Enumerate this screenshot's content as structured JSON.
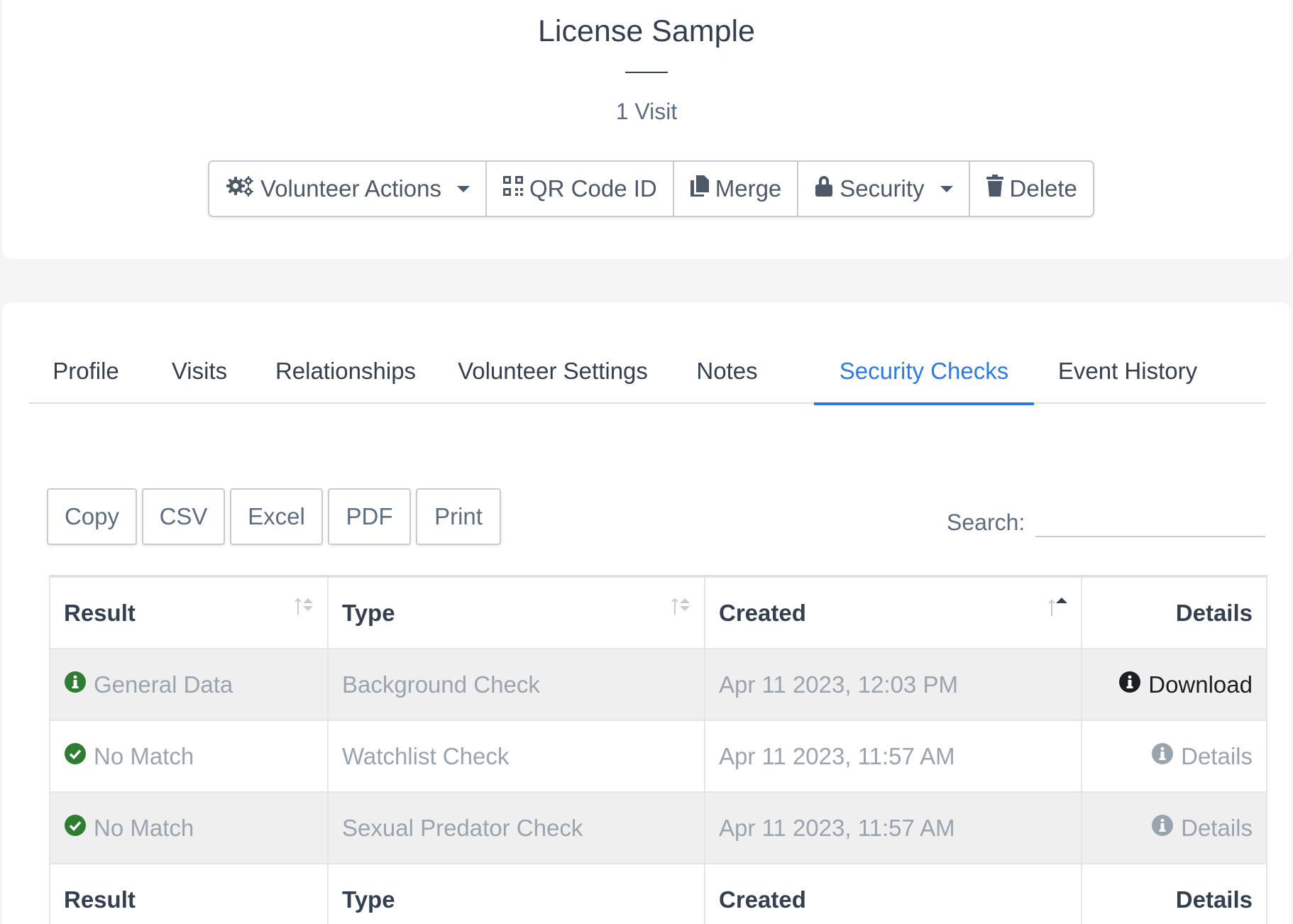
{
  "header": {
    "title": "License Sample",
    "visits": "1 Visit"
  },
  "actions": {
    "volunteer_actions": "Volunteer Actions",
    "qr_code": "QR Code ID",
    "merge": "Merge",
    "security": "Security",
    "delete": "Delete"
  },
  "tabs": [
    {
      "label": "Profile"
    },
    {
      "label": "Visits"
    },
    {
      "label": "Relationships"
    },
    {
      "label": "Volunteer Settings"
    },
    {
      "label": "Notes"
    },
    {
      "label": "Security Checks",
      "active": true
    },
    {
      "label": "Event History"
    }
  ],
  "toolbar": {
    "copy": "Copy",
    "csv": "CSV",
    "excel": "Excel",
    "pdf": "PDF",
    "print": "Print",
    "search_label": "Search:",
    "search_value": ""
  },
  "table": {
    "columns": [
      "Result",
      "Type",
      "Created",
      "Details"
    ],
    "sort": {
      "column": "Created",
      "direction": "ascending"
    },
    "rows": [
      {
        "result": "General Data",
        "result_icon": "info-circle-icon",
        "type": "Background Check",
        "created": "Apr 11 2023, 12:03 PM",
        "details": "Download",
        "details_icon": "info-circle-icon"
      },
      {
        "result": "No Match",
        "result_icon": "check-circle-icon",
        "type": "Watchlist Check",
        "created": "Apr 11 2023, 11:57 AM",
        "details": "Details",
        "details_icon": "info-circle-icon"
      },
      {
        "result": "No Match",
        "result_icon": "check-circle-icon",
        "type": "Sexual Predator Check",
        "created": "Apr 11 2023, 11:57 AM",
        "details": "Details",
        "details_icon": "info-circle-icon"
      }
    ]
  },
  "colors": {
    "accent": "#2c7be5",
    "success": "#2e7d32",
    "text": "#344050",
    "muted": "#9aa4ae"
  }
}
